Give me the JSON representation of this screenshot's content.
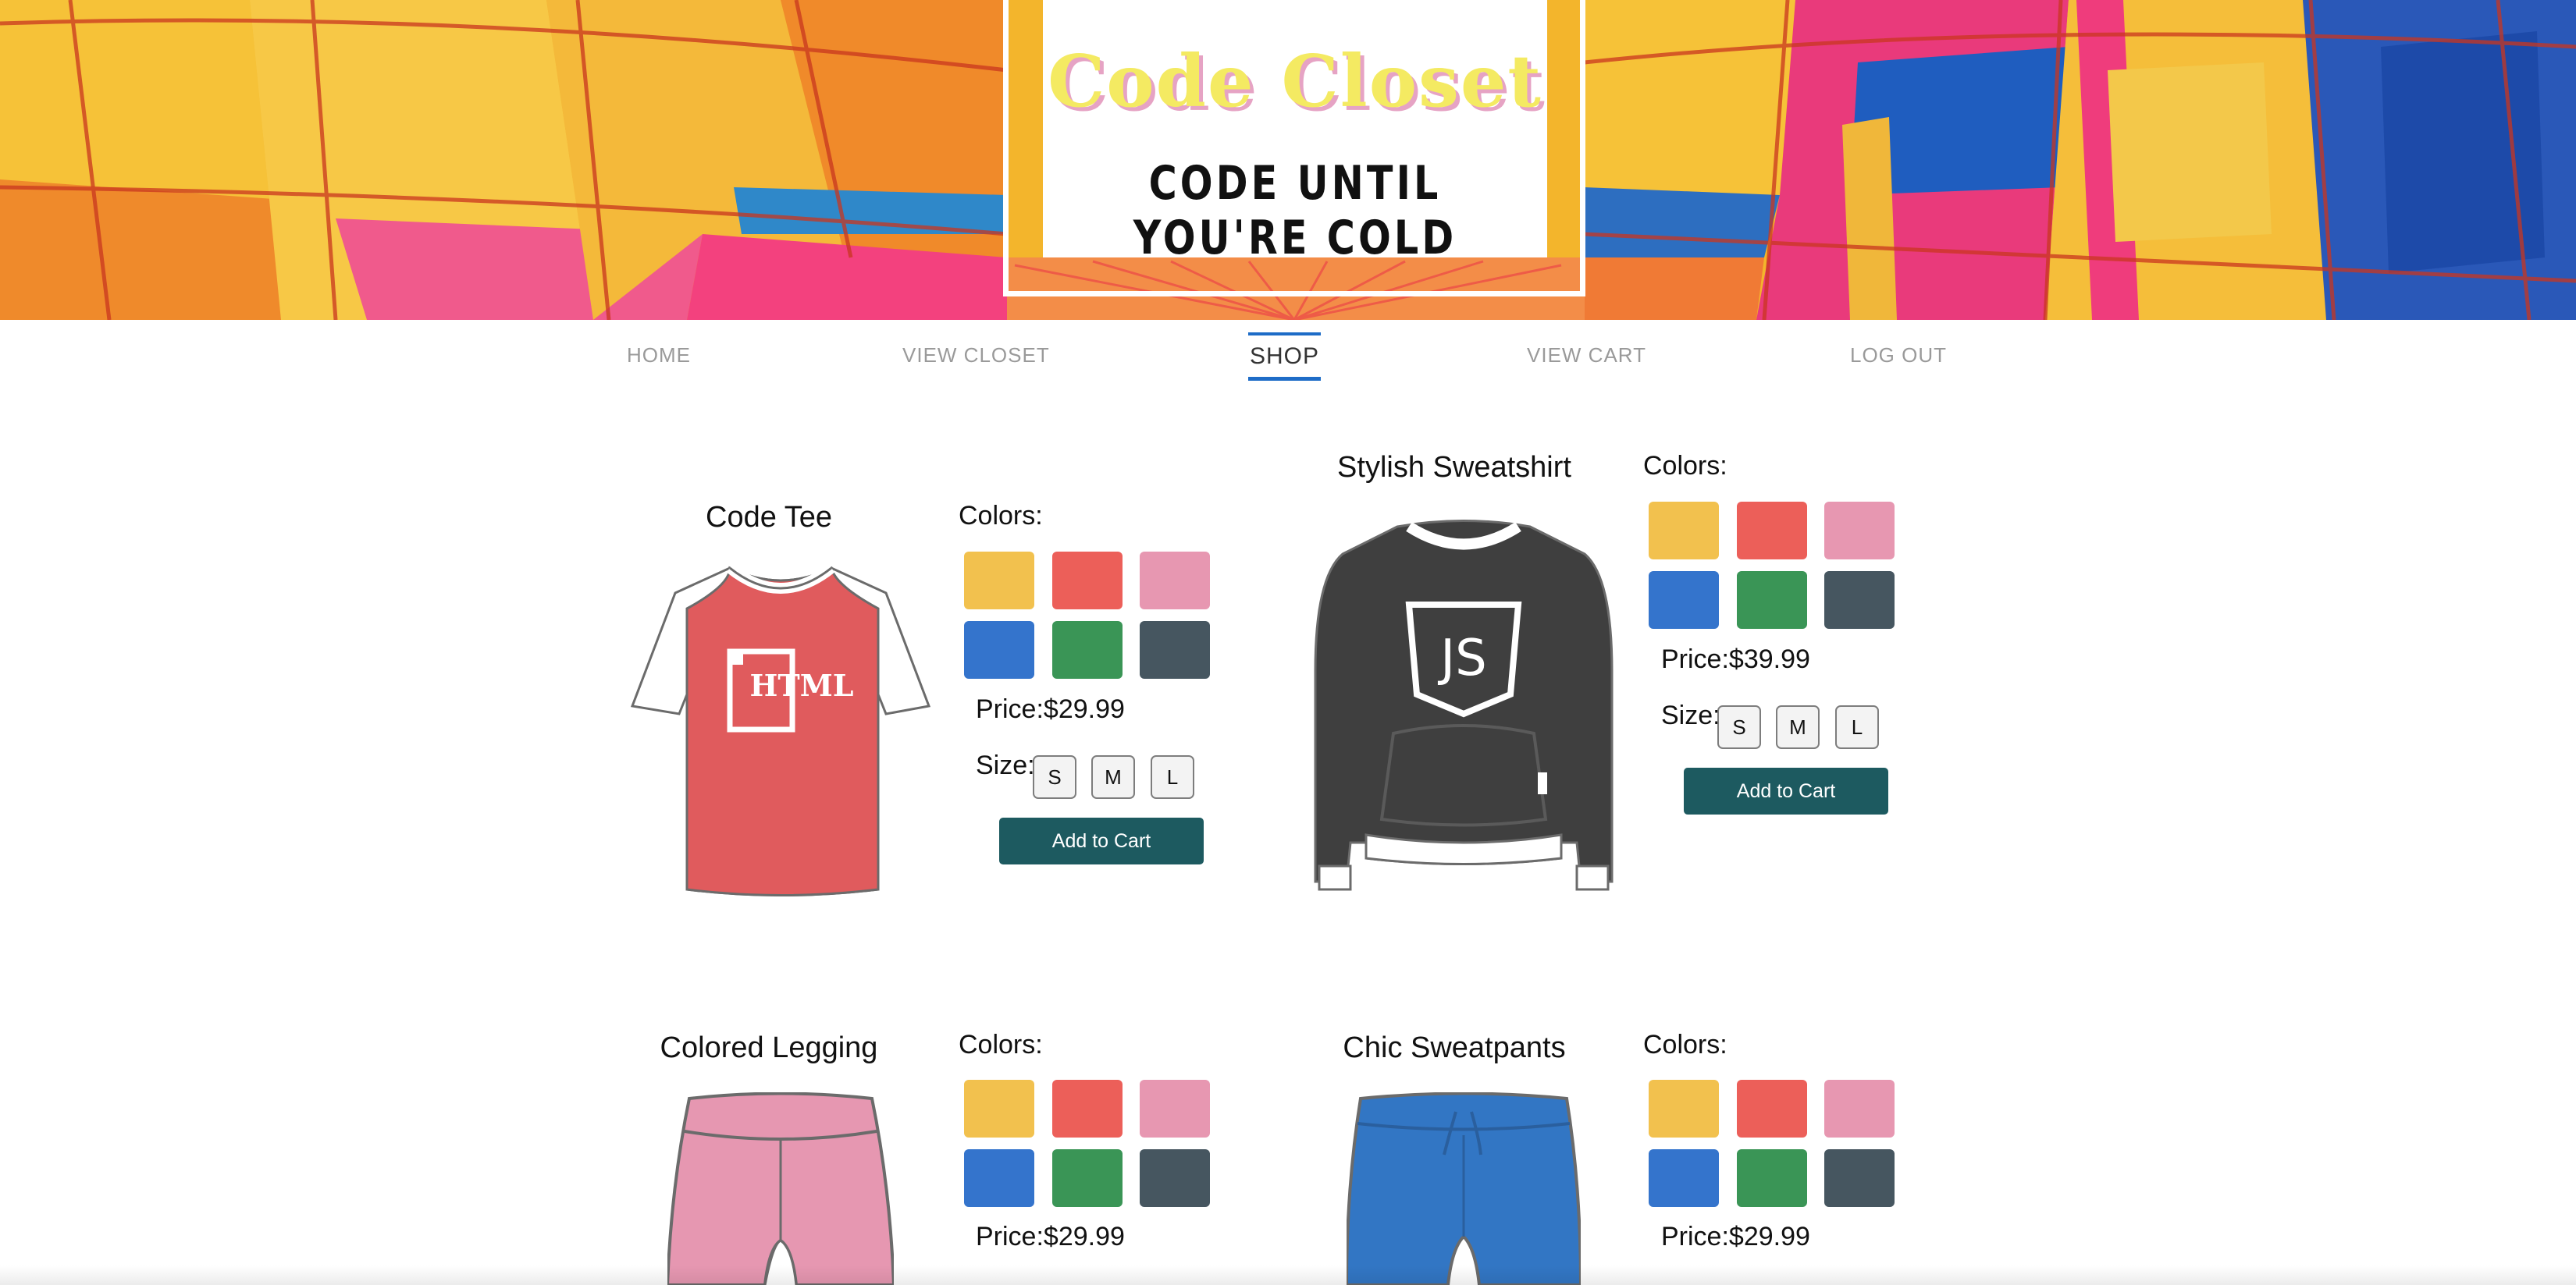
{
  "brand": {
    "title": "Code Closet",
    "tagline": "CODE UNTIL YOU'RE COLD"
  },
  "nav": {
    "items": [
      {
        "label": "HOME",
        "active": false
      },
      {
        "label": "VIEW CLOSET",
        "active": false
      },
      {
        "label": "SHOP",
        "active": true
      },
      {
        "label": "VIEW CART",
        "active": false
      },
      {
        "label": "LOG OUT",
        "active": false
      }
    ]
  },
  "shop": {
    "colors_label": "Colors:",
    "size_label": "Size:",
    "sizes": [
      "S",
      "M",
      "L"
    ],
    "add_to_cart_label": "Add to Cart",
    "swatch_colors": [
      "#f2c14e",
      "#ec5f59",
      "#e797b1",
      "#3474cc",
      "#3a9556",
      "#465660"
    ],
    "products": [
      {
        "name": "Code Tee",
        "price": "Price:$29.99",
        "image_icon": "html-tshirt-icon",
        "shirt_text": "HTML"
      },
      {
        "name": "Stylish Sweatshirt",
        "price": "Price:$39.99",
        "image_icon": "js-sweatshirt-icon",
        "shirt_text": "JS"
      },
      {
        "name": "Colored Legging",
        "price": "Price:$29.99",
        "image_icon": "pink-legging-icon"
      },
      {
        "name": "Chic Sweatpants",
        "price": "Price:$29.99",
        "image_icon": "blue-sweatpants-icon"
      }
    ]
  }
}
